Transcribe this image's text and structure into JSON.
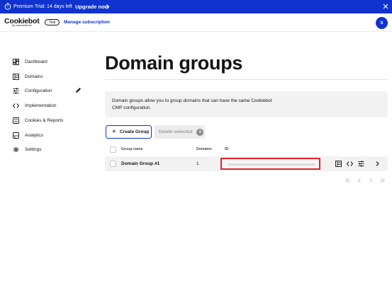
{
  "banner": {
    "trial_text": "Premium Trial: 14 days left",
    "upgrade_label": "Upgrade now",
    "background": "#1032cf"
  },
  "header": {
    "logo_text": "Cookiebot",
    "logo_subtext": "by Usercentrics",
    "trial_badge": "Trial",
    "manage_label": "Manage subscription",
    "avatar_initial": "S"
  },
  "sidebar": {
    "items": [
      {
        "label": "Dashboard",
        "icon": "dashboard-icon"
      },
      {
        "label": "Domains",
        "icon": "domains-icon"
      },
      {
        "label": "Configuration",
        "icon": "configuration-icon"
      },
      {
        "label": "Implementation",
        "icon": "code-icon"
      },
      {
        "label": "Cookies & Reports",
        "icon": "cookies-icon"
      },
      {
        "label": "Analytics",
        "icon": "analytics-icon"
      },
      {
        "label": "Settings",
        "icon": "gear-icon"
      }
    ]
  },
  "main": {
    "title": "Domain groups",
    "info_line1": "Domain groups allow you to group domains that can have the same Cookiebot",
    "info_line2": "CMP configuration.",
    "create_label": "Create Group",
    "delete_label": "Delete selected",
    "delete_count": "0",
    "table": {
      "headers": [
        "Group name",
        "Domains",
        "ID"
      ],
      "rows": [
        {
          "name": "Domain Group #1",
          "domains": "1",
          "id": ""
        }
      ]
    },
    "accent": "#1032cf",
    "highlight": "#d9252a"
  }
}
